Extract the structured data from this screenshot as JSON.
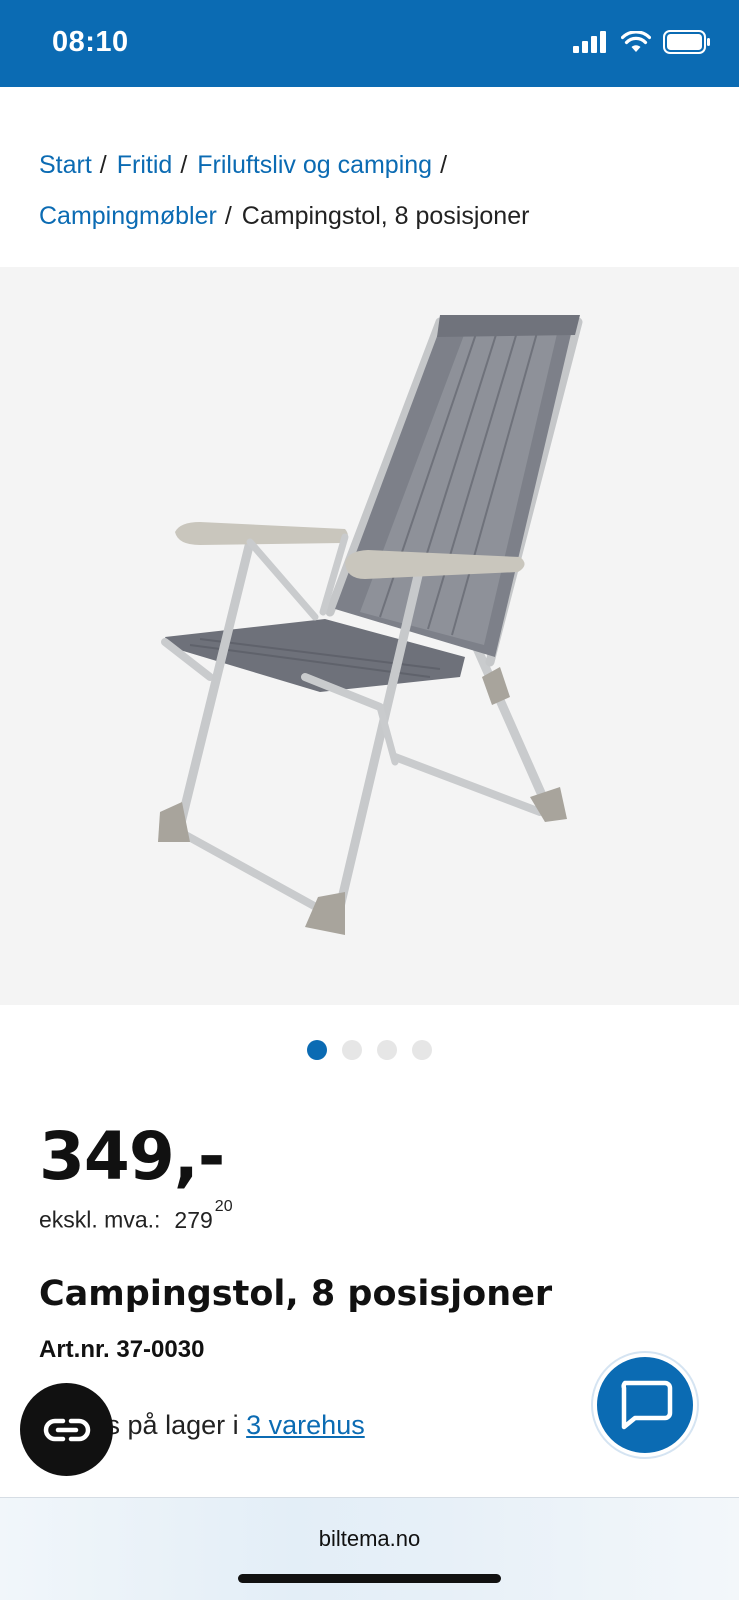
{
  "status_bar": {
    "time": "08:10",
    "signal_icon": "cellular-signal-icon",
    "wifi_icon": "wifi-icon",
    "battery_icon": "battery-icon"
  },
  "breadcrumb": {
    "items": [
      {
        "label": "Start"
      },
      {
        "label": "Fritid"
      },
      {
        "label": "Friluftsliv og camping"
      },
      {
        "label": "Campingmøbler"
      }
    ],
    "separator": "/",
    "current": "Campingstol, 8 posisjoner"
  },
  "gallery": {
    "image": "folding-camping-chair-image",
    "total_images": 4,
    "active_index": 0
  },
  "product": {
    "price": "349,-",
    "ex_vat_label": "ekskl. mva.:",
    "ex_vat_whole": "279",
    "ex_vat_cents": "20",
    "title": "Campingstol, 8 posisjoner",
    "art_nr": "Art.nr. 37-0030",
    "stock_prefix": "Finnes på lager i",
    "stock_link": "3 varehus"
  },
  "buttons": {
    "left_fab_icon": "link-icon",
    "chat_fab_icon": "chat-bubble-icon"
  },
  "browser": {
    "url": "biltema.no"
  },
  "colors": {
    "brand_blue": "#0b6bb3",
    "gallery_bg": "#f4f4f4"
  }
}
